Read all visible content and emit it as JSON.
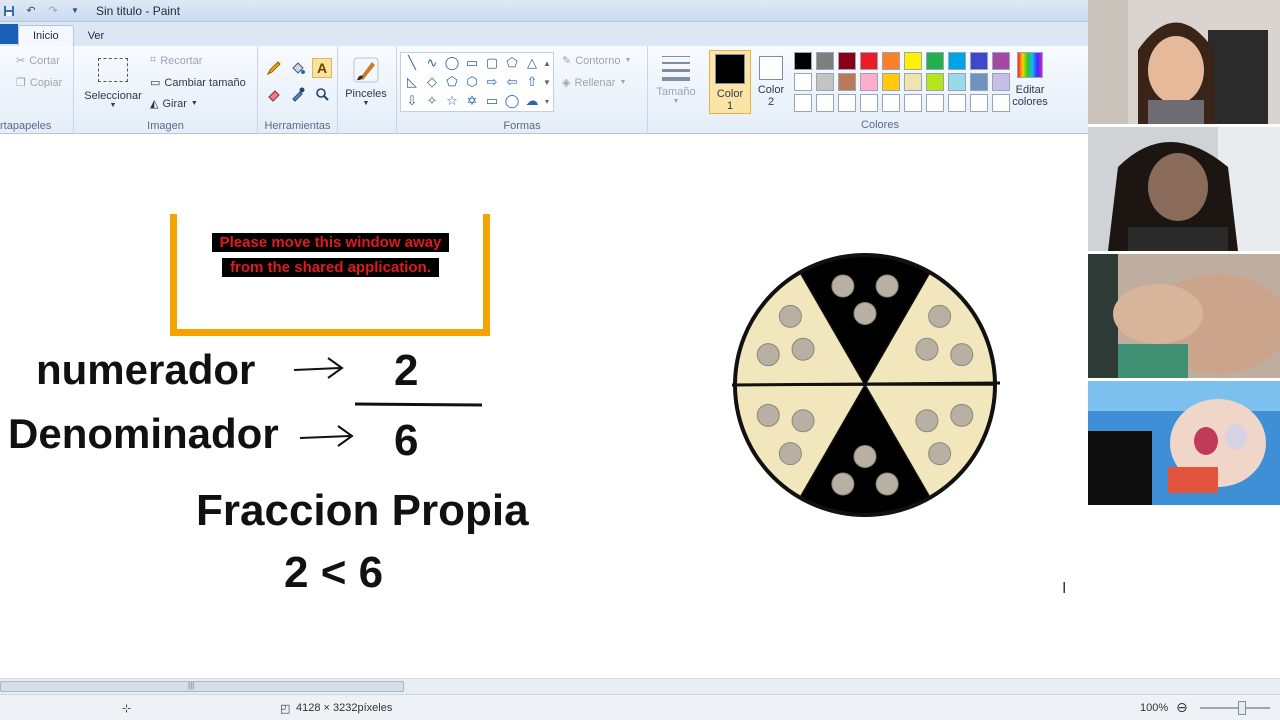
{
  "window": {
    "title": "Sin titulo - Paint"
  },
  "tabs": [
    {
      "label": "Inicio",
      "active": true
    },
    {
      "label": "Ver",
      "active": false
    }
  ],
  "ribbon": {
    "clipboard": {
      "cut": "Cortar",
      "copy": "Copiar",
      "group_label": "rtapapeles"
    },
    "image": {
      "select": "Seleccionar",
      "crop": "Recortar",
      "resize": "Cambiar tamaño",
      "rotate": "Girar",
      "group_label": "Imagen"
    },
    "tools": {
      "group_label": "Herramientas"
    },
    "brushes": {
      "label": "Pinceles"
    },
    "shapes": {
      "outline": "Contorno",
      "fill": "Rellenar",
      "group_label": "Formas"
    },
    "size": {
      "label": "Tamaño"
    },
    "colors": {
      "color1_label": "Color",
      "color1_num": "1",
      "color2_label": "Color",
      "color2_num": "2",
      "edit_line1": "Editar",
      "edit_line2": "colores",
      "group_label": "Colores",
      "color1_value": "#000000",
      "color2_value": "#ffffff",
      "palette_row1": [
        "#000000",
        "#7f7f7f",
        "#880015",
        "#ed1c24",
        "#ff7f27",
        "#fff200",
        "#22b14c",
        "#00a2e8",
        "#3f48cc",
        "#a349a4"
      ],
      "palette_row2": [
        "#ffffff",
        "#c3c3c3",
        "#b97a57",
        "#ffaec9",
        "#ffc90e",
        "#efe4b0",
        "#b5e61d",
        "#99d9ea",
        "#7092be",
        "#c8bfe7"
      ]
    }
  },
  "canvas": {
    "share_message_line1": "Please move this window away",
    "share_message_line2": "from the shared application.",
    "numerator_label": "numerador",
    "denominator_label": "Denominador",
    "numerator_value": "2",
    "denominator_value": "6",
    "title": "Fraccion Propia",
    "comparison": "2 < 6",
    "pie": {
      "total_slices": 6,
      "dark_slices": 2,
      "dark_color": "#000000",
      "light_color": "#f1e6bc"
    }
  },
  "status": {
    "dimensions": "4128 × 3232píxeles",
    "zoom": "100%"
  }
}
